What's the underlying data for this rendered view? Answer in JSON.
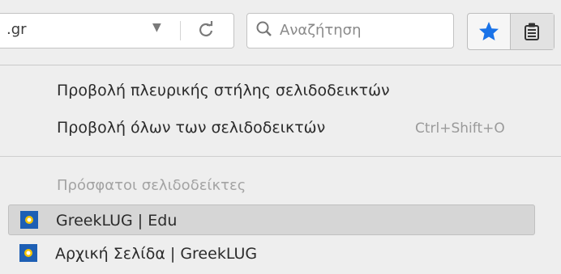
{
  "toolbar": {
    "url_text": ".gr",
    "search_placeholder": "Αναζήτηση",
    "icons": {
      "dropdown": "chevron-down-icon",
      "reload": "reload-icon",
      "search": "search-icon",
      "bookmark_star": "star-icon",
      "library": "library-icon"
    }
  },
  "menu": {
    "items": [
      {
        "label": "Προβολή πλευρικής στήλης σελιδοδεικτών"
      },
      {
        "label": "Προβολή όλων των σελιδοδεικτών",
        "shortcut": "Ctrl+Shift+O"
      }
    ],
    "recent_header": "Πρόσφατοι σελιδοδείκτες",
    "bookmarks": [
      {
        "label": "GreekLUG | Edu",
        "icon": "greeklug-favicon"
      },
      {
        "label": "Αρχική Σελίδα | GreekLUG",
        "icon": "greeklug-favicon"
      }
    ]
  },
  "colors": {
    "star": "#1a73e8",
    "panel_bg": "#eeeeee",
    "hover_bg": "#d6d6d6"
  }
}
